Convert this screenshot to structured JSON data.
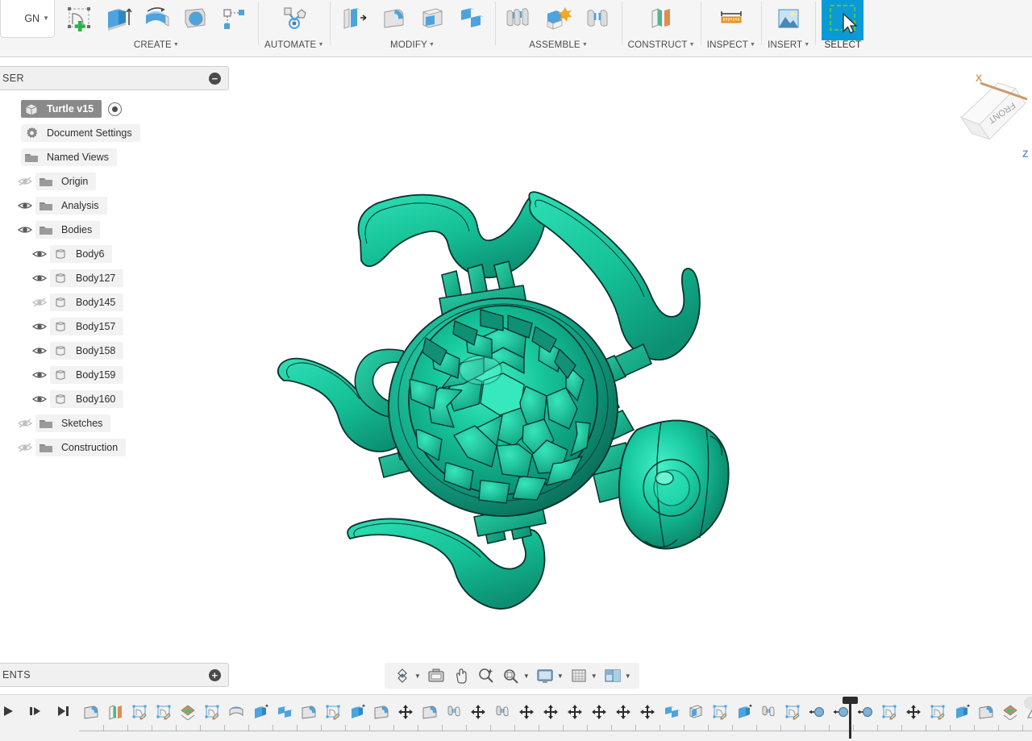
{
  "app": {
    "design_tab_label": "GN",
    "accent_blue": "#0a9ad6",
    "model_teal": "#19b894",
    "model_teal_dark": "#0c7a63",
    "canvas_bg": "#ffffff"
  },
  "toolbar": {
    "groups": [
      {
        "label": "CREATE",
        "has_caret": true,
        "icons": [
          {
            "name": "create-sketch-icon"
          },
          {
            "name": "extrude-icon"
          },
          {
            "name": "revolve-icon"
          },
          {
            "name": "sweep-icon"
          },
          {
            "name": "pattern-icon"
          }
        ]
      },
      {
        "label": "AUTOMATE",
        "has_caret": true,
        "icons": [
          {
            "name": "automate-icon"
          }
        ]
      },
      {
        "label": "MODIFY",
        "has_caret": true,
        "icons": [
          {
            "name": "press-pull-icon"
          },
          {
            "name": "fillet-icon"
          },
          {
            "name": "shell-icon"
          },
          {
            "name": "combine-icon"
          }
        ]
      },
      {
        "label": "ASSEMBLE",
        "has_caret": true,
        "icons": [
          {
            "name": "new-component-icon"
          },
          {
            "name": "joint-icon"
          },
          {
            "name": "as-built-joint-icon"
          }
        ]
      },
      {
        "label": "CONSTRUCT",
        "has_caret": true,
        "icons": [
          {
            "name": "offset-plane-icon"
          }
        ]
      },
      {
        "label": "INSPECT",
        "has_caret": true,
        "icons": [
          {
            "name": "measure-icon"
          }
        ]
      },
      {
        "label": "INSERT",
        "has_caret": true,
        "icons": [
          {
            "name": "insert-image-icon"
          }
        ]
      },
      {
        "label": "SELECT",
        "has_caret": false,
        "icons": [
          {
            "name": "select-cursor-icon"
          }
        ]
      }
    ]
  },
  "browser": {
    "title": "SER",
    "collapse_button": "collapse-icon",
    "tree": [
      {
        "label": "Turtle v15",
        "icon": "component-icon",
        "eye": "none",
        "indent": 0,
        "selected": true,
        "radio": true
      },
      {
        "label": "Document Settings",
        "icon": "gear-icon",
        "eye": "none",
        "indent": 0,
        "selected": false,
        "radio": false
      },
      {
        "label": "Named Views",
        "icon": "folder-icon",
        "eye": "none",
        "indent": 0,
        "selected": false,
        "radio": false
      },
      {
        "label": "Origin",
        "icon": "folder-icon",
        "eye": "hidden",
        "indent": 1,
        "selected": false,
        "radio": false
      },
      {
        "label": "Analysis",
        "icon": "folder-icon",
        "eye": "visible",
        "indent": 1,
        "selected": false,
        "radio": false
      },
      {
        "label": "Bodies",
        "icon": "folder-icon",
        "eye": "visible",
        "indent": 1,
        "selected": false,
        "radio": false
      },
      {
        "label": "Body6",
        "icon": "body-icon",
        "eye": "visible",
        "indent": 2,
        "selected": false,
        "radio": false
      },
      {
        "label": "Body127",
        "icon": "body-icon",
        "eye": "visible",
        "indent": 2,
        "selected": false,
        "radio": false
      },
      {
        "label": "Body145",
        "icon": "body-icon",
        "eye": "hidden",
        "indent": 2,
        "selected": false,
        "radio": false
      },
      {
        "label": "Body157",
        "icon": "body-icon",
        "eye": "visible",
        "indent": 2,
        "selected": false,
        "radio": false
      },
      {
        "label": "Body158",
        "icon": "body-icon",
        "eye": "visible",
        "indent": 2,
        "selected": false,
        "radio": false
      },
      {
        "label": "Body159",
        "icon": "body-icon",
        "eye": "visible",
        "indent": 2,
        "selected": false,
        "radio": false
      },
      {
        "label": "Body160",
        "icon": "body-icon",
        "eye": "visible",
        "indent": 2,
        "selected": false,
        "radio": false
      },
      {
        "label": "Sketches",
        "icon": "folder-icon",
        "eye": "hidden",
        "indent": 1,
        "selected": false,
        "radio": false
      },
      {
        "label": "Construction",
        "icon": "folder-icon",
        "eye": "hidden",
        "indent": 1,
        "selected": false,
        "radio": false
      }
    ]
  },
  "viewcube": {
    "face_label": "FRONT",
    "axis_x": "X",
    "axis_z": "Z"
  },
  "navbar": {
    "items": [
      {
        "name": "orbit-icon",
        "caret": true
      },
      {
        "name": "look-at-icon",
        "caret": false
      },
      {
        "name": "pan-icon",
        "caret": false
      },
      {
        "name": "zoom-icon",
        "caret": false
      },
      {
        "name": "zoom-fit-icon",
        "caret": true
      },
      {
        "name": "display-settings-icon",
        "caret": true
      },
      {
        "name": "grid-snaps-icon",
        "caret": true
      },
      {
        "name": "viewports-icon",
        "caret": true
      }
    ]
  },
  "comments": {
    "title": "ENTS",
    "expand_button": "expand-icon"
  },
  "timeline": {
    "playback": [
      {
        "name": "play-icon"
      },
      {
        "name": "step-forward-icon"
      },
      {
        "name": "skip-to-end-icon"
      }
    ],
    "features": [
      {
        "name": "fillet-feature-icon",
        "kind": "fillet"
      },
      {
        "name": "plane-feature-icon",
        "kind": "plane"
      },
      {
        "name": "sketch-feature-icon",
        "kind": "sketch"
      },
      {
        "name": "sketch-feature-icon",
        "kind": "sketch"
      },
      {
        "name": "plane-angle-feature-icon",
        "kind": "planeangle"
      },
      {
        "name": "sketch-feature-icon",
        "kind": "sketch"
      },
      {
        "name": "revolve-feature-icon",
        "kind": "revolve"
      },
      {
        "name": "extrude-feature-icon",
        "kind": "extrude"
      },
      {
        "name": "combine-feature-icon",
        "kind": "combine"
      },
      {
        "name": "fillet-feature-icon",
        "kind": "fillet"
      },
      {
        "name": "sketch-feature-icon",
        "kind": "sketch"
      },
      {
        "name": "extrude-feature-icon",
        "kind": "extrude"
      },
      {
        "name": "fillet-feature-icon",
        "kind": "fillet"
      },
      {
        "name": "move-feature-icon",
        "kind": "move"
      },
      {
        "name": "fillet-feature-icon",
        "kind": "fillet"
      },
      {
        "name": "joint-feature-icon",
        "kind": "joint"
      },
      {
        "name": "move-feature-icon",
        "kind": "move"
      },
      {
        "name": "joint-feature-icon",
        "kind": "joint"
      },
      {
        "name": "move-feature-icon",
        "kind": "move"
      },
      {
        "name": "move-feature-icon",
        "kind": "move"
      },
      {
        "name": "move-feature-icon",
        "kind": "move"
      },
      {
        "name": "move-feature-icon",
        "kind": "move"
      },
      {
        "name": "move-feature-icon",
        "kind": "move"
      },
      {
        "name": "move-feature-icon",
        "kind": "move"
      },
      {
        "name": "combine-feature-icon",
        "kind": "combine"
      },
      {
        "name": "shell-feature-icon",
        "kind": "shell"
      },
      {
        "name": "sketch-feature-icon",
        "kind": "sketch"
      },
      {
        "name": "extrude-feature-icon",
        "kind": "extrude"
      },
      {
        "name": "joint-feature-icon",
        "kind": "joint"
      },
      {
        "name": "sketch-feature-icon",
        "kind": "sketch"
      },
      {
        "name": "rigid-group-feature-icon",
        "kind": "rigid"
      },
      {
        "name": "rigid-group-feature-icon",
        "kind": "rigid"
      },
      {
        "name": "rigid-group-feature-icon",
        "kind": "rigid"
      },
      {
        "name": "sketch-feature-icon",
        "kind": "sketch"
      },
      {
        "name": "move-feature-icon",
        "kind": "move"
      },
      {
        "name": "sketch-feature-icon",
        "kind": "sketch"
      },
      {
        "name": "extrude-feature-icon",
        "kind": "extrude"
      },
      {
        "name": "fillet-feature-icon",
        "kind": "fillet"
      },
      {
        "name": "plane-angle-feature-icon",
        "kind": "planeangle"
      },
      {
        "name": "draft-feature-icon",
        "kind": "draft"
      },
      {
        "name": "split-feature-icon",
        "kind": "split"
      }
    ]
  },
  "model": {
    "name": "turtle-3d-model",
    "description": "Articulated sea turtle with tessellated hexagonal shell",
    "body_color": "#14b391",
    "edge_color": "#0d3d33",
    "highlight_color": "#35e8bd"
  }
}
